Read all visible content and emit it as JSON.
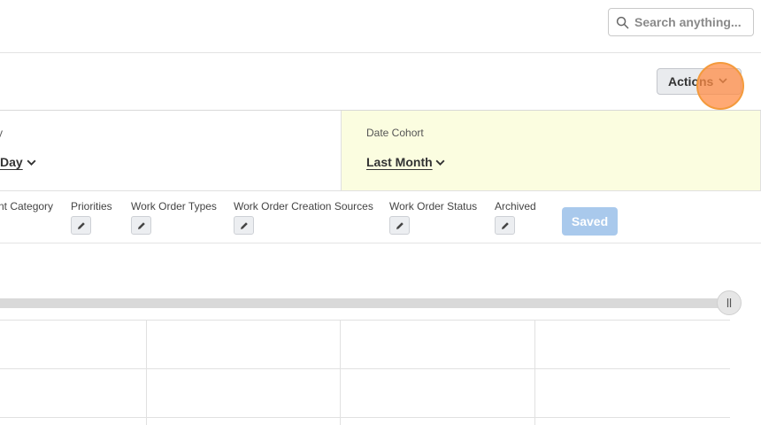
{
  "header": {
    "search_placeholder": "Search anything..."
  },
  "toolbar": {
    "actions_label": "Actions"
  },
  "cells": {
    "left": {
      "label": "y",
      "value": "Day"
    },
    "right": {
      "label": "Date Cohort",
      "value": "Last Month"
    }
  },
  "filters": [
    {
      "label": "nt Category"
    },
    {
      "label": "Priorities"
    },
    {
      "label": "Work Order Types"
    },
    {
      "label": "Work Order Creation Sources"
    },
    {
      "label": "Work Order Status"
    },
    {
      "label": "Archived"
    }
  ],
  "saved_label": "Saved",
  "colors": {
    "date_cohort_bg": "#fbfde0",
    "saved_button": "#a9c9ec",
    "actions_button": "#e9ebee"
  }
}
